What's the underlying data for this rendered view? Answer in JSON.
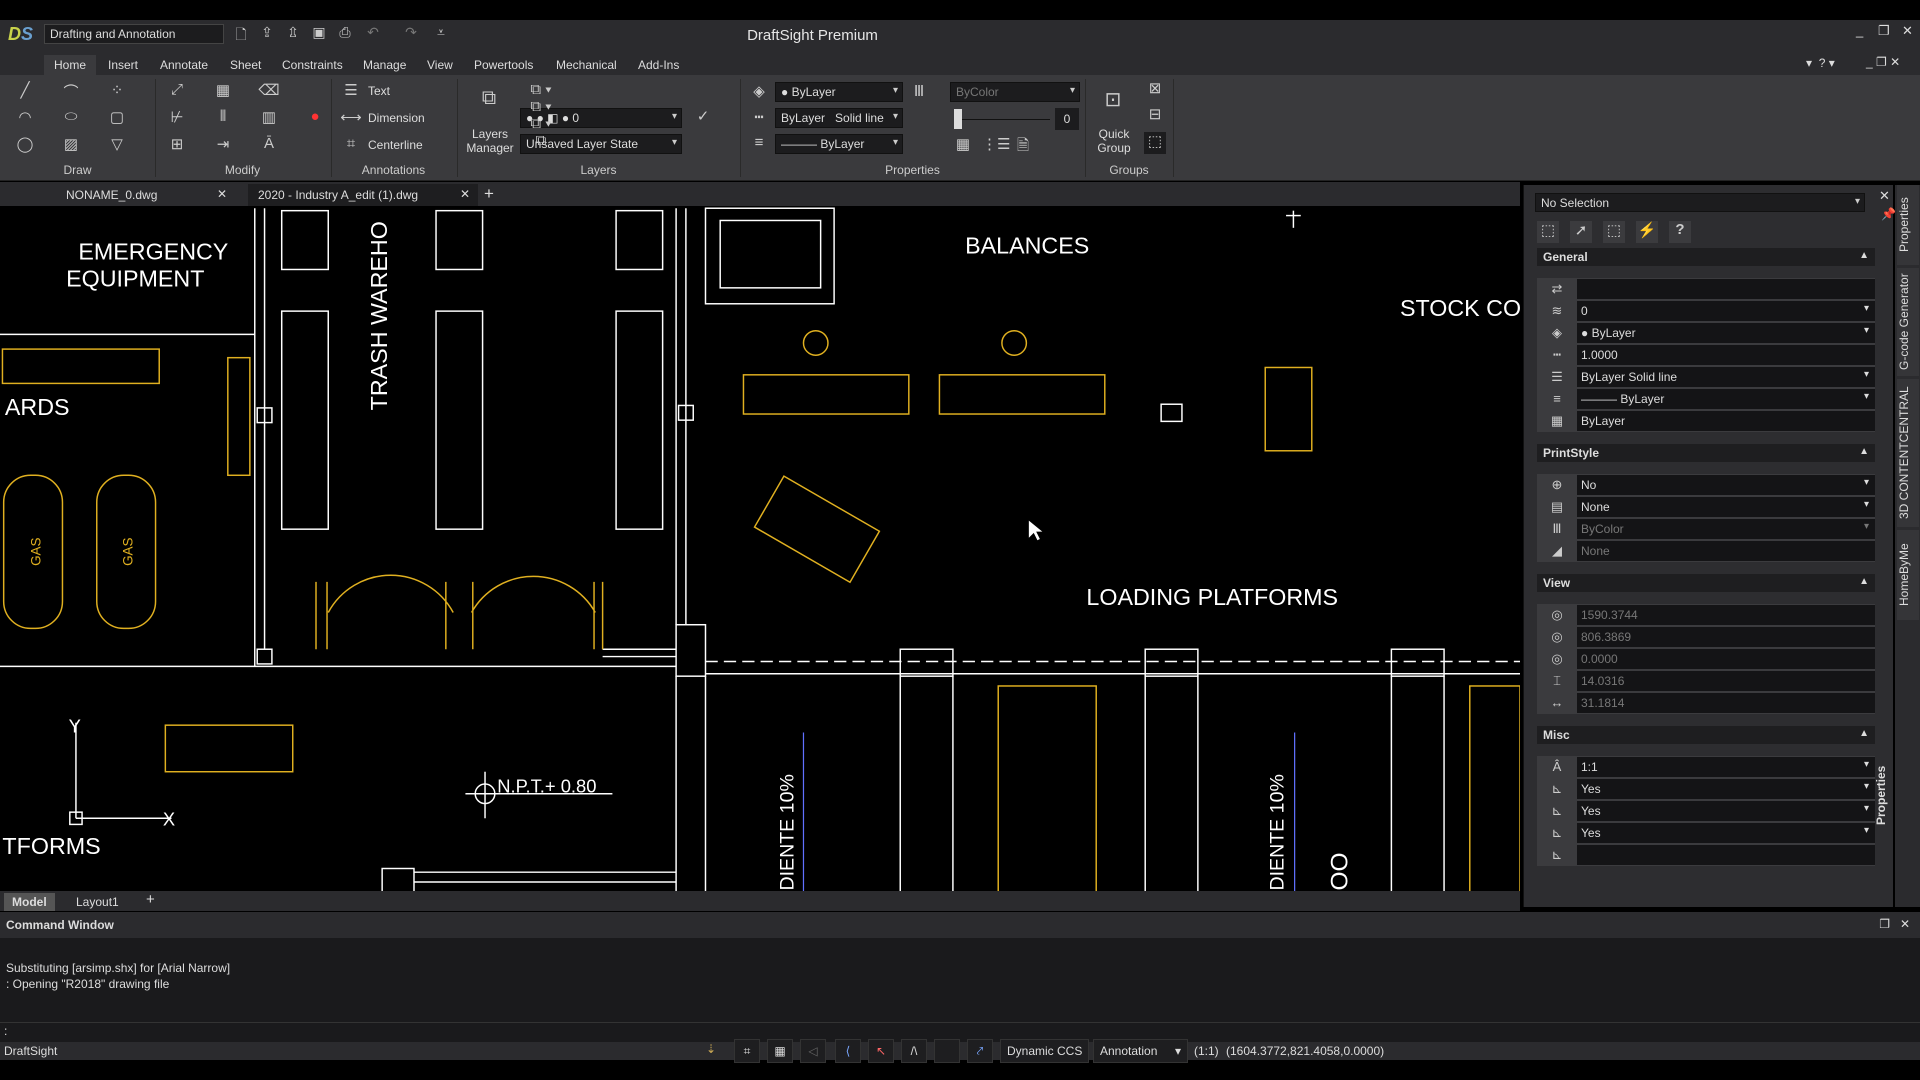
{
  "app": {
    "title": "DraftSight Premium",
    "workspace": "Drafting and Annotation",
    "logo": "DS"
  },
  "quick_access": [
    "new-icon",
    "open-icon",
    "open-folder-icon",
    "save-icon",
    "print-icon",
    "undo-icon",
    "redo-icon",
    "customize-icon"
  ],
  "ribbon_tabs": [
    "Home",
    "Insert",
    "Annotate",
    "Sheet",
    "Constraints",
    "Manage",
    "View",
    "Powertools",
    "Mechanical",
    "Add-Ins"
  ],
  "ribbon": {
    "groups": [
      "Draw",
      "Modify",
      "Annotations",
      "Layers",
      "Properties",
      "Groups"
    ],
    "annotations": {
      "text": "Text",
      "dimension": "Dimension",
      "centerline": "Centerline"
    },
    "layers": {
      "manager": "Layers Manager",
      "current_layer": "0",
      "layer_state": "Unsaved Layer State"
    },
    "properties": {
      "color": "ByLayer",
      "linetype_scale": "ByLayer",
      "linetype": "Solid line",
      "lineweight": "ByLayer",
      "print_color": "ByColor",
      "transparency": "0"
    },
    "groups_panel": {
      "quick_group": "Quick Group"
    }
  },
  "document_tabs": [
    {
      "label": "NONAME_0.dwg"
    },
    {
      "label": "2020 - Industry A_edit (1).dwg",
      "active": true
    }
  ],
  "canvas": {
    "labels": {
      "emergency": "EMERGENCY",
      "equipment": "EQUIPMENT",
      "trash": "TRASH WAREHO",
      "balances": "BALANCES",
      "stock": "STOCK CO",
      "ards": "ARDS",
      "loading": "LOADING PLATFORMS",
      "tforms": "TFORMS",
      "npt": "N.P.T.+ 0.80",
      "diente1": "DIENTE 10%",
      "diente2": "DIENTE 10%",
      "gas": "GAS",
      "axis_x": "X",
      "axis_y": "Y",
      "oo": "OO"
    },
    "colors": {
      "yellow": "#e0b020",
      "white": "#ffffff"
    }
  },
  "layout_tabs": [
    "Model",
    "Layout1"
  ],
  "properties_panel": {
    "selection": "No Selection",
    "tools": [
      "quick-select-icon",
      "select-icon",
      "window-select-icon",
      "filter-icon",
      "help-icon"
    ],
    "sections": [
      {
        "title": "General",
        "rows": [
          {
            "icon": "⇄",
            "value": ""
          },
          {
            "icon": "≋",
            "value": "0",
            "drop": true
          },
          {
            "icon": "◈",
            "value": "● ByLayer",
            "drop": true
          },
          {
            "icon": "┅",
            "value": "1.0000"
          },
          {
            "icon": "☰",
            "value": "ByLayer      Solid line",
            "drop": true
          },
          {
            "icon": "≡",
            "value": "——— ByLayer",
            "drop": true
          },
          {
            "icon": "▦",
            "value": "ByLayer"
          }
        ]
      },
      {
        "title": "PrintStyle",
        "rows": [
          {
            "icon": "⊕",
            "value": "No",
            "drop": true
          },
          {
            "icon": "▤",
            "value": "None",
            "drop": true
          },
          {
            "icon": "Ⅲ",
            "value": "ByColor",
            "dis": true,
            "drop": true
          },
          {
            "icon": "◢",
            "value": "None",
            "dis": true
          }
        ]
      },
      {
        "title": "View",
        "rows": [
          {
            "icon": "◎",
            "value": "1590.3744",
            "dis": true
          },
          {
            "icon": "◎",
            "value": "806.3869",
            "dis": true
          },
          {
            "icon": "◎",
            "value": "0.0000",
            "dis": true
          },
          {
            "icon": "⌶",
            "value": "14.0316",
            "dis": true
          },
          {
            "icon": "↔",
            "value": "31.1814",
            "dis": true
          }
        ]
      },
      {
        "title": "Misc",
        "rows": [
          {
            "icon": "Â",
            "value": "1:1",
            "drop": true
          },
          {
            "icon": "⊾",
            "value": "Yes",
            "drop": true
          },
          {
            "icon": "⊾",
            "value": "Yes",
            "drop": true
          },
          {
            "icon": "⊾",
            "value": "Yes",
            "drop": true
          },
          {
            "icon": "⊾",
            "value": ""
          }
        ]
      }
    ]
  },
  "side_tabs": [
    "Properties",
    "G-code Generator",
    "3D CONTENTCENTRAL",
    "HomeByMe"
  ],
  "panel_tab_bottom": "Properties",
  "command_window": {
    "title": "Command Window",
    "lines": [
      "Substituting [arsimp.shx] for [Arial Narrow]",
      ": Opening \"R2018\" drawing file"
    ],
    "prompt": ":"
  },
  "status_bar": {
    "app": "DraftSight",
    "dynamic_ccs": "Dynamic CCS",
    "annotation": "Annotation",
    "scale": "(1:1)",
    "coords": "(1604.3772,821.4058,0.0000)"
  }
}
